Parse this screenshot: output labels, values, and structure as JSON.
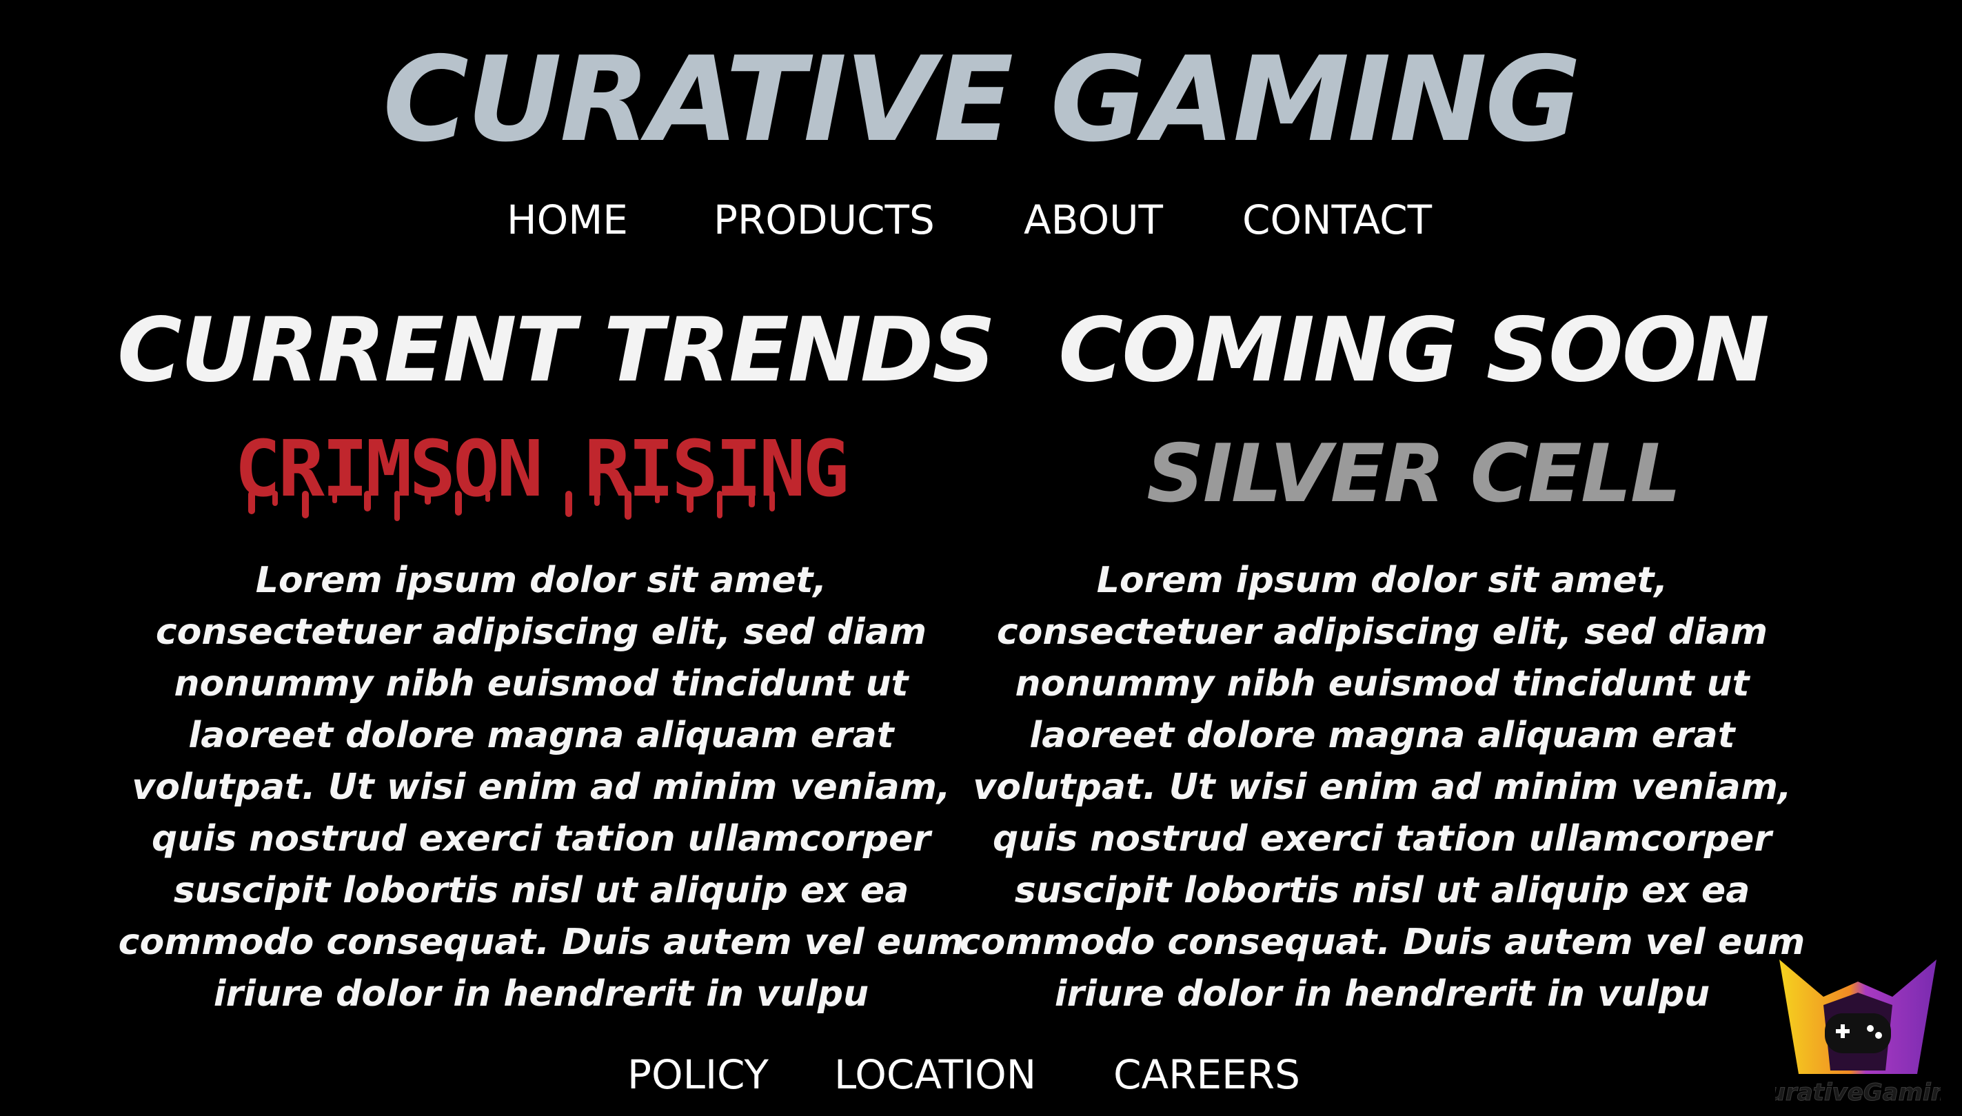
{
  "header": {
    "title": "CURATIVE GAMING"
  },
  "nav": {
    "items": [
      {
        "label": "HOME"
      },
      {
        "label": "PRODUCTS"
      },
      {
        "label": "ABOUT"
      },
      {
        "label": "CONTACT"
      }
    ]
  },
  "sections": {
    "current": {
      "heading": "CURRENT TRENDS",
      "game_title": "CRIMSON RISING",
      "body": "Lorem ipsum dolor sit amet, consectetuer adipiscing elit, sed diam nonummy nibh euismod tincidunt ut laoreet dolore magna aliquam erat volutpat. Ut wisi enim ad minim veniam, quis nostrud exerci tation ullamcorper suscipit lobortis nisl ut aliquip ex ea commodo consequat. Duis autem vel eum iriure dolor in hendrerit in vulpu"
    },
    "upcoming": {
      "heading": "COMING SOON",
      "game_title": "SILVER CELL",
      "body": "Lorem ipsum dolor sit amet, consectetuer adipiscing elit, sed diam nonummy nibh euismod tincidunt ut laoreet dolore magna aliquam erat volutpat. Ut wisi enim ad minim veniam, quis nostrud exerci tation ullamcorper suscipit lobortis nisl ut aliquip ex ea commodo consequat. Duis autem vel eum iriure dolor in hendrerit in vulpu"
    }
  },
  "footer": {
    "links": [
      {
        "label": "POLICY"
      },
      {
        "label": "LOCATION"
      },
      {
        "label": "CAREERS"
      }
    ]
  },
  "logo": {
    "icon": "gamepad-shield-logo-icon",
    "text": "CurativeGaming"
  },
  "colors": {
    "background": "#000000",
    "title": "#b7c2cb",
    "crimson": "#c0262d",
    "silver": "#9a9a9a",
    "text": "#ffffff"
  }
}
